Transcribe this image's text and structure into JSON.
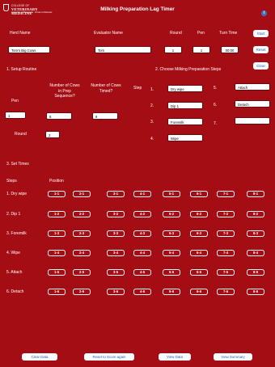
{
  "header": {
    "logo_line1": "COLLEGE OF",
    "logo_line2": "VETERINARY MEDICINE",
    "logo_line3": "University of Minnesota · Driven to Discover",
    "title": "Milking Preparation Lag Timer",
    "info_label": "i"
  },
  "top_form": {
    "herd_label": "Herd Name",
    "herd_value": "Tom's Big Cows",
    "evaluator_label": "Evaluator Name",
    "evaluator_value": "Tom",
    "round_label": "Round",
    "round_value": "1",
    "pen_label": "Pen",
    "pen_value": "1",
    "turn_time_label": "Turn Time",
    "turn_time_value": "00:00",
    "start_label": "Start",
    "reset_label": "Reset",
    "clear_label": "Clear"
  },
  "setup": {
    "heading": "1. Setup Routine",
    "pen_label": "Pen",
    "pen_value": "1",
    "prep_label": "Number of Cows in Prep Sequence?",
    "prep_value": "8",
    "timed_label": "Number of Cows Timed?",
    "timed_value": "8",
    "round_label": "Round",
    "round_value": "2"
  },
  "steps_choice": {
    "heading": "2. Choose Milking Preparation Steps",
    "step_label": "Step",
    "items": [
      {
        "num": "1.",
        "value": "Dry wipe"
      },
      {
        "num": "2.",
        "value": "Dip 1"
      },
      {
        "num": "3.",
        "value": "Foremilk"
      },
      {
        "num": "4.",
        "value": "Wipe"
      },
      {
        "num": "5.",
        "value": "Attach"
      },
      {
        "num": "6.",
        "value": "Detach"
      },
      {
        "num": "7.",
        "value": ""
      }
    ]
  },
  "set_times": {
    "heading": "3. Set Times",
    "steps_col": "Steps",
    "position_col": "Position",
    "rows": [
      {
        "label": "1. Dry wipe",
        "buttons": [
          "1-1",
          "2-1",
          "3-1",
          "4-1",
          "5-1",
          "6-1",
          "7-1",
          "8-1"
        ]
      },
      {
        "label": "2. Dip 1",
        "buttons": [
          "1-2",
          "2-2",
          "3-2",
          "4-2",
          "5-2",
          "6-2",
          "7-2",
          "8-2"
        ]
      },
      {
        "label": "3. Foremilk",
        "buttons": [
          "1-3",
          "2-3",
          "3-3",
          "4-3",
          "5-3",
          "6-3",
          "7-3",
          "8-3"
        ]
      },
      {
        "label": "4. Wipe",
        "buttons": [
          "1-4",
          "2-4",
          "3-4",
          "4-4",
          "5-4",
          "6-4",
          "7-4",
          "8-4"
        ]
      },
      {
        "label": "5. Attach",
        "buttons": [
          "1-5",
          "2-5",
          "3-5",
          "4-5",
          "5-5",
          "6-5",
          "7-5",
          "8-5"
        ]
      },
      {
        "label": "6. Detach",
        "buttons": [
          "1-6",
          "2-6",
          "3-6",
          "4-6",
          "5-6",
          "6-6",
          "7-6",
          "8-6"
        ]
      }
    ]
  },
  "footer": {
    "clear_data": "Clear Data",
    "reset_score": "Reset to Score again",
    "view_data": "View Data",
    "view_summary": "View Summary"
  },
  "colors": {
    "background": "#a40d14",
    "button_text": "#1a5fb4",
    "info_icon": "#3b73c9"
  }
}
